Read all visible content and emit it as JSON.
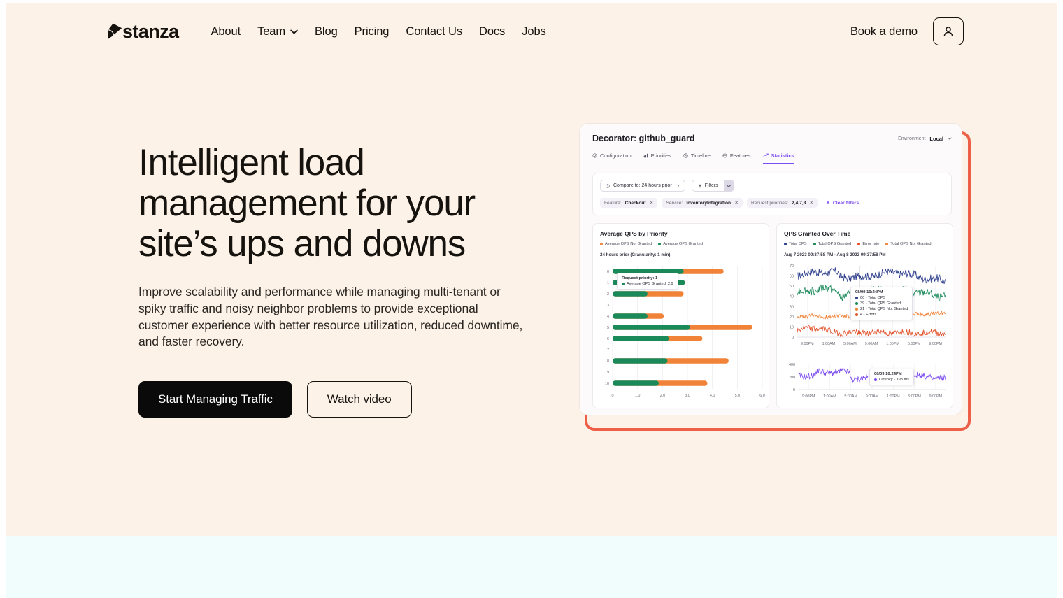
{
  "brand": {
    "name": "stanza",
    "logo_icon": "stanza-diamond-logo"
  },
  "nav": {
    "links": [
      {
        "label": "About",
        "icon": null
      },
      {
        "label": "Team",
        "icon": "chevron-down-icon"
      },
      {
        "label": "Blog",
        "icon": null
      },
      {
        "label": "Pricing",
        "icon": null
      },
      {
        "label": "Contact Us",
        "icon": null
      },
      {
        "label": "Docs",
        "icon": null
      },
      {
        "label": "Jobs",
        "icon": null
      }
    ],
    "demo_label": "Book a demo",
    "account_icon": "user-account-icon"
  },
  "hero": {
    "headline": "Intelligent load management for your site’s ups and downs",
    "subhead": "Improve scalability and performance while managing multi-tenant or spiky traffic and noisy neighbor problems to provide exceptional customer experience with better resource utilization, reduced downtime, and faster recovery.",
    "primary_cta": "Start Managing Traffic",
    "secondary_cta": "Watch video"
  },
  "colors": {
    "hero_bg": "#FDF2E8",
    "below_bg": "#F1FCFC",
    "accent_frame": "#EE5F48",
    "text": "#16130F",
    "primary_button": "#0A0A0A",
    "dashboard_accent": "#7C4DF0",
    "series_granted": "#1B8A5A",
    "series_not_granted": "#F08338",
    "series_total_qps": "#2D3E8C",
    "series_error": "#E2522B",
    "series_latency": "#7C4DF0"
  },
  "dashboard": {
    "title": "Decorator: github_guard",
    "environment_label": "Environment",
    "environment_value": "Local",
    "environment_caret": "chevron-down-icon",
    "tabs": [
      {
        "label": "Configuration",
        "icon": "gear-icon",
        "active": false
      },
      {
        "label": "Priorities",
        "icon": "bar-chart-icon",
        "active": false
      },
      {
        "label": "Timeline",
        "icon": "clock-icon",
        "active": false
      },
      {
        "label": "Features",
        "icon": "grid-icon",
        "active": false
      },
      {
        "label": "Statistics",
        "icon": "trending-up-icon",
        "active": true
      }
    ],
    "filters": {
      "compare_label": "Compare to: 24 hours prior",
      "compare_icon": "clock-icon",
      "filters_label": "Filters",
      "filters_icon": "funnel-icon",
      "chips": [
        {
          "key": "Feature:",
          "value": "Checkout"
        },
        {
          "key": "Service:",
          "value": "InventoryIntegration"
        },
        {
          "key": "Request priorities:",
          "value": "2,4,7,8"
        }
      ],
      "clear_label": "Clear filters",
      "clear_icon": "close-icon"
    },
    "left_panel": {
      "title": "Average QPS by Priority",
      "legend": [
        {
          "label": "Average QPS Not Granted",
          "color": "#F08338"
        },
        {
          "label": "Average QPS Granted",
          "color": "#1B8A5A"
        }
      ],
      "subtitle": "24 hours prior (Granularity: 1 min)",
      "tooltip": {
        "title": "Request priority: 1",
        "rows": [
          {
            "label": "Average QPS Granted: 2.9",
            "color": "#1B8A5A"
          }
        ]
      }
    },
    "right_panel": {
      "title": "QPS Granted Over Time",
      "legend": [
        {
          "label": "Total QPS",
          "color": "#2D3E8C"
        },
        {
          "label": "Total QPS Granted",
          "color": "#1B8A5A"
        },
        {
          "label": "Error rate",
          "color": "#E2522B"
        },
        {
          "label": "Total QPS Not Granted",
          "color": "#F08338"
        }
      ],
      "subtitle": "Aug 7 2023 09:37:58 PM - Aug 8 2023 09:37:58 PM",
      "tooltip": {
        "title": "08/09 10:24PM",
        "rows": [
          {
            "label": "60 - Total QPS",
            "color": "#2D3E8C"
          },
          {
            "label": "39 - Total QPS Granted",
            "color": "#1B8A5A"
          },
          {
            "label": "21 - Total QPS Not Granted",
            "color": "#F08338"
          },
          {
            "label": "4 - Errors",
            "color": "#E2522B"
          }
        ]
      },
      "latency_tooltip": {
        "title": "08/09 10:24PM",
        "rows": [
          {
            "label": "Latency - 193 ms",
            "color": "#7C4DF0"
          }
        ]
      }
    }
  },
  "chart_data": [
    {
      "type": "bar",
      "id": "average-qps-by-priority",
      "title": "Average QPS by Priority",
      "orientation": "horizontal",
      "stacked": true,
      "categories": [
        "0",
        "1",
        "2",
        "3",
        "4",
        "5",
        "6",
        "7",
        "8",
        "9",
        "10"
      ],
      "series": [
        {
          "name": "Average QPS Granted",
          "color": "#1B8A5A",
          "values": [
            2.85,
            2.9,
            1.4,
            0,
            1.4,
            3.1,
            2.25,
            0,
            2.2,
            0,
            1.85
          ]
        },
        {
          "name": "Average QPS Not Granted",
          "color": "#F08338",
          "values": [
            1.6,
            0,
            1.45,
            0,
            0.65,
            2.5,
            1.35,
            0,
            2.45,
            0,
            1.95
          ]
        }
      ],
      "xlabel": "",
      "ylabel": "",
      "xlim": [
        0,
        6.0
      ],
      "xticks": [
        "0",
        "1.0",
        "2.0",
        "3.0",
        "4.0",
        "5.0",
        "6.0"
      ],
      "grid": true,
      "legend_position": "top"
    },
    {
      "type": "line",
      "id": "qps-granted-over-time",
      "title": "QPS Granted Over Time",
      "subtitle": "Aug 7 2023 09:37:58 PM - Aug 8 2023 09:37:58 PM",
      "xticks": [
        "9:00PM",
        "1:00AM",
        "5:00AM",
        "9:00AM",
        "1:00PM",
        "5:00PM",
        "9:00PM"
      ],
      "yticks": [
        "0",
        "10",
        "20",
        "30",
        "40",
        "50",
        "60",
        "70"
      ],
      "ylim": [
        0,
        70
      ],
      "series": [
        {
          "name": "Total QPS",
          "color": "#2D3E8C",
          "baseline": 61,
          "amplitude": 4
        },
        {
          "name": "Total QPS Granted",
          "color": "#1B8A5A",
          "baseline": 44,
          "amplitude": 4
        },
        {
          "name": "Total QPS Not Granted",
          "color": "#F08338",
          "baseline": 20,
          "amplitude": 2
        },
        {
          "name": "Error rate",
          "color": "#E2522B",
          "baseline": 6,
          "amplitude": 3
        }
      ],
      "grid": true,
      "legend_position": "top",
      "highlight": {
        "x": "08/09 10:24PM",
        "Total QPS": 60,
        "Total QPS Granted": 39,
        "Total QPS Not Granted": 21,
        "Errors": 4
      }
    },
    {
      "type": "line",
      "id": "latency-over-time",
      "title": "Latency",
      "xticks": [
        "9:00PM",
        "1:00AM",
        "5:00AM",
        "9:00AM",
        "1:00PM",
        "5:00PM",
        "9:00PM"
      ],
      "yticks": [
        "0",
        "200",
        "400"
      ],
      "ylim": [
        0,
        400
      ],
      "series": [
        {
          "name": "Latency",
          "color": "#7C4DF0",
          "baseline": 220,
          "amplitude": 50,
          "unit": "ms"
        }
      ],
      "grid": true,
      "highlight": {
        "x": "08/09 10:24PM",
        "Latency": "193 ms"
      }
    }
  ]
}
